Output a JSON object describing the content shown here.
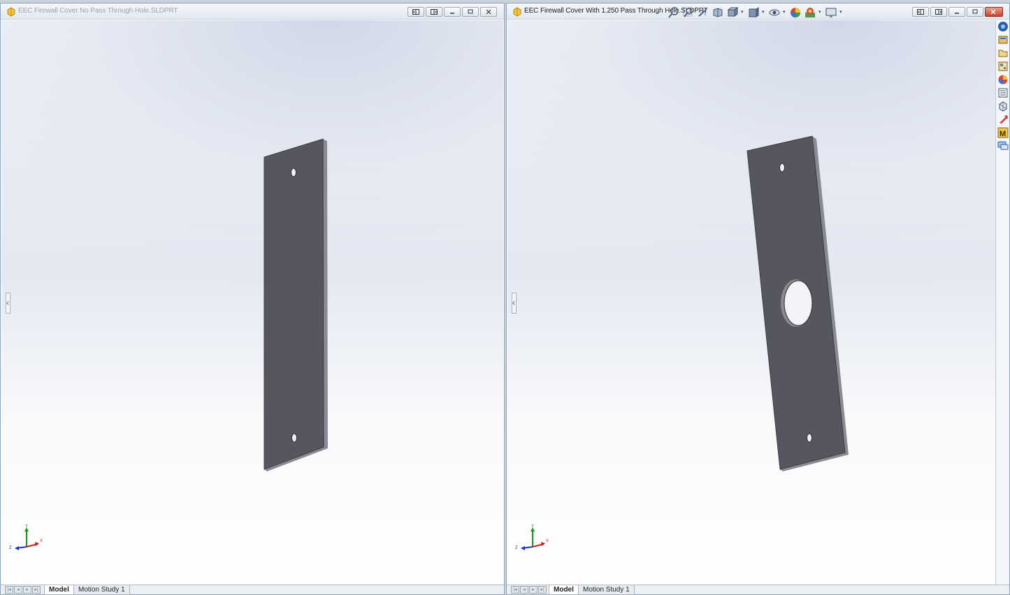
{
  "left_window": {
    "title": "EEC Firewall Cover No Pass Through Hole.SLDPRT",
    "tabs": [
      "Model",
      "Motion Study 1"
    ],
    "active_tab": "Model",
    "triad_labels": {
      "y": "Y",
      "x": "X",
      "z": "Z"
    }
  },
  "right_window": {
    "title": "EEC Firewall Cover With 1.250 Pass Through Hole.SLDPRT",
    "tabs": [
      "Model",
      "Motion Study 1"
    ],
    "active_tab": "Model",
    "triad_labels": {
      "y": "Y",
      "x": "X",
      "z": "Z"
    },
    "heads_up_toolbar": [
      "zoom-to-fit-icon",
      "zoom-to-area-icon",
      "previous-view-icon",
      "section-view-icon",
      "view-orientation-icon",
      "display-style-icon",
      "hide-show-items-icon",
      "edit-appearance-icon",
      "apply-scene-icon",
      "view-settings-icon"
    ],
    "task_pane": [
      "solidworks-resources-icon",
      "design-library-icon",
      "file-explorer-icon",
      "view-palette-icon",
      "appearances-icon",
      "custom-properties-icon",
      "3d-content-central-icon",
      "mbd-icon",
      "motor-icon",
      "forum-icon"
    ]
  },
  "window_buttons": [
    "tile-left-icon",
    "tile-right-icon",
    "minimize-icon",
    "restore-icon",
    "close-icon"
  ],
  "colors": {
    "part_face": "#55565e",
    "part_edge": "#8a8b92",
    "accent_close": "#c7442c"
  }
}
